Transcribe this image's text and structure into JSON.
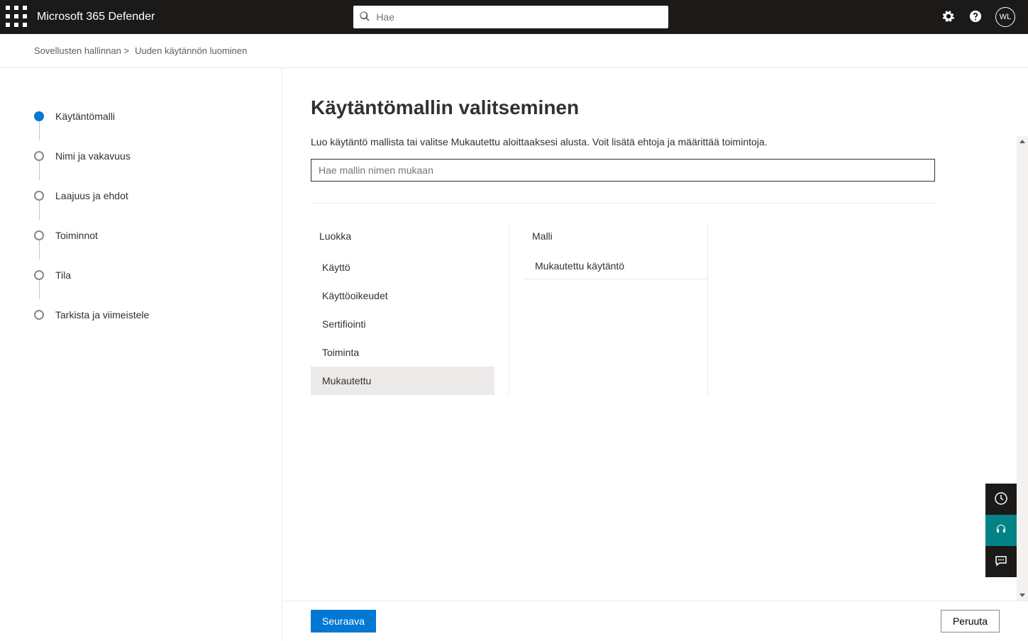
{
  "header": {
    "app_title": "Microsoft 365 Defender",
    "search_placeholder": "Hae",
    "user_initials": "WL"
  },
  "breadcrumb": {
    "part1": "Sovellusten hallinnan >",
    "part2": "Uuden käytännön luominen"
  },
  "stepper": {
    "steps": [
      {
        "label": "Käytäntömalli"
      },
      {
        "label": "Nimi ja vakavuus"
      },
      {
        "label": "Laajuus ja ehdot"
      },
      {
        "label": "Toiminnot"
      },
      {
        "label": "Tila"
      },
      {
        "label": "Tarkista ja viimeistele"
      }
    ]
  },
  "main": {
    "heading": "Käytäntömallin valitseminen",
    "subtitle": "Luo käytäntö mallista tai valitse Mukautettu aloittaaksesi alusta. Voit lisätä ehtoja ja määrittää toimintoja.",
    "search_placeholder": "Hae mallin nimen mukaan",
    "category_header": "Luokka",
    "categories": [
      {
        "label": "Käyttö"
      },
      {
        "label": "Käyttöoikeudet"
      },
      {
        "label": "Sertifiointi"
      },
      {
        "label": "Toiminta"
      },
      {
        "label": "Mukautettu"
      }
    ],
    "template_header": "Malli",
    "templates": [
      {
        "label": "Mukautettu käytäntö"
      }
    ]
  },
  "footer": {
    "next_label": "Seuraava",
    "cancel_label": "Peruuta"
  }
}
